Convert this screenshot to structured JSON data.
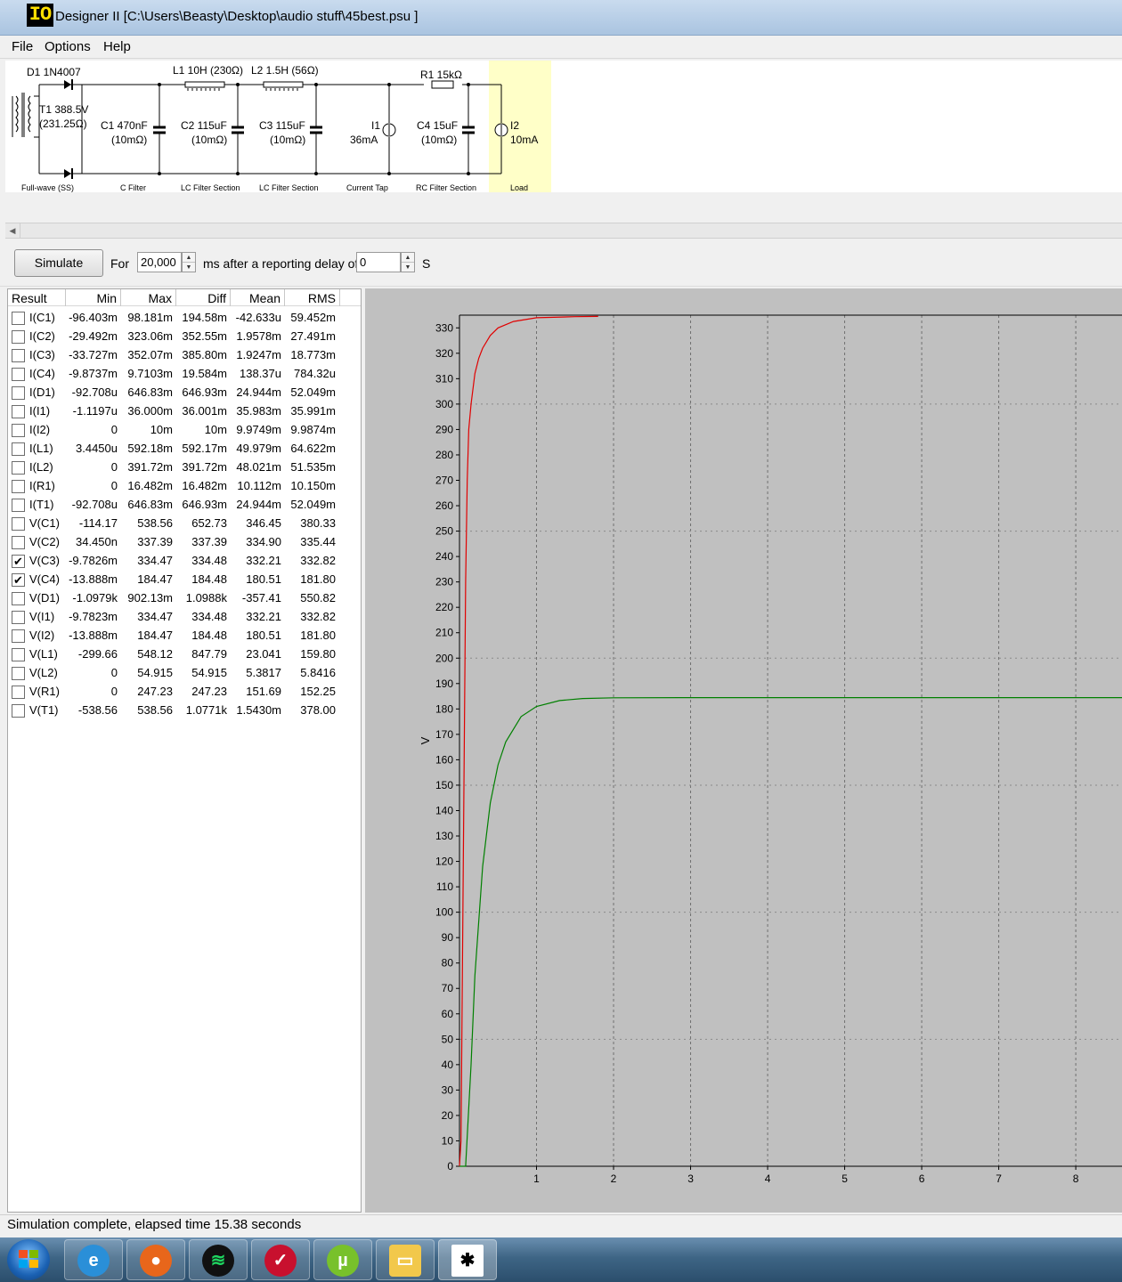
{
  "window": {
    "logo": "IO",
    "title": "Designer II  [C:\\Users\\Beasty\\Desktop\\audio stuff\\45best.psu ]"
  },
  "menu": {
    "file": "File",
    "options": "Options",
    "help": "Help"
  },
  "schematic": {
    "d1": "D1 1N4007",
    "t1_a": "T1 388.5V",
    "t1_b": "(231.25Ω)",
    "l1": "L1 10H (230Ω)",
    "l2": "L2 1.5H (56Ω)",
    "r1": "R1 15kΩ",
    "c1_a": "C1 470nF",
    "c1_b": "(10mΩ)",
    "c2_a": "C2 115uF",
    "c2_b": "(10mΩ)",
    "c3_a": "C3 115uF",
    "c3_b": "(10mΩ)",
    "i1_a": "I1",
    "i1_b": "36mA",
    "c4_a": "C4 15uF",
    "c4_b": "(10mΩ)",
    "i2_a": "I2",
    "i2_b": "10mA",
    "sections": [
      "Full-wave (SS)",
      "C Filter",
      "LC Filter Section",
      "LC Filter Section",
      "Current Tap",
      "RC Filter Section",
      "Load"
    ]
  },
  "toolbar": {
    "simulate": "Simulate",
    "for_label": "For",
    "duration": "20,000",
    "ms_label": "ms  after a reporting delay of",
    "delay": "0",
    "s_label": "S"
  },
  "results": {
    "columns": [
      "Result",
      "Min",
      "Max",
      "Diff",
      "Mean",
      "RMS"
    ],
    "rows": [
      {
        "checked": false,
        "name": "I(C1)",
        "min": "-96.403m",
        "max": "98.181m",
        "diff": "194.58m",
        "mean": "-42.633u",
        "rms": "59.452m"
      },
      {
        "checked": false,
        "name": "I(C2)",
        "min": "-29.492m",
        "max": "323.06m",
        "diff": "352.55m",
        "mean": "1.9578m",
        "rms": "27.491m"
      },
      {
        "checked": false,
        "name": "I(C3)",
        "min": "-33.727m",
        "max": "352.07m",
        "diff": "385.80m",
        "mean": "1.9247m",
        "rms": "18.773m"
      },
      {
        "checked": false,
        "name": "I(C4)",
        "min": "-9.8737m",
        "max": "9.7103m",
        "diff": "19.584m",
        "mean": "138.37u",
        "rms": "784.32u"
      },
      {
        "checked": false,
        "name": "I(D1)",
        "min": "-92.708u",
        "max": "646.83m",
        "diff": "646.93m",
        "mean": "24.944m",
        "rms": "52.049m"
      },
      {
        "checked": false,
        "name": "I(I1)",
        "min": "-1.1197u",
        "max": "36.000m",
        "diff": "36.001m",
        "mean": "35.983m",
        "rms": "35.991m"
      },
      {
        "checked": false,
        "name": "I(I2)",
        "min": "0",
        "max": "10m",
        "diff": "10m",
        "mean": "9.9749m",
        "rms": "9.9874m"
      },
      {
        "checked": false,
        "name": "I(L1)",
        "min": "3.4450u",
        "max": "592.18m",
        "diff": "592.17m",
        "mean": "49.979m",
        "rms": "64.622m"
      },
      {
        "checked": false,
        "name": "I(L2)",
        "min": "0",
        "max": "391.72m",
        "diff": "391.72m",
        "mean": "48.021m",
        "rms": "51.535m"
      },
      {
        "checked": false,
        "name": "I(R1)",
        "min": "0",
        "max": "16.482m",
        "diff": "16.482m",
        "mean": "10.112m",
        "rms": "10.150m"
      },
      {
        "checked": false,
        "name": "I(T1)",
        "min": "-92.708u",
        "max": "646.83m",
        "diff": "646.93m",
        "mean": "24.944m",
        "rms": "52.049m"
      },
      {
        "checked": false,
        "name": "V(C1)",
        "min": "-114.17",
        "max": "538.56",
        "diff": "652.73",
        "mean": "346.45",
        "rms": "380.33"
      },
      {
        "checked": false,
        "name": "V(C2)",
        "min": "34.450n",
        "max": "337.39",
        "diff": "337.39",
        "mean": "334.90",
        "rms": "335.44"
      },
      {
        "checked": true,
        "name": "V(C3)",
        "min": "-9.7826m",
        "max": "334.47",
        "diff": "334.48",
        "mean": "332.21",
        "rms": "332.82"
      },
      {
        "checked": true,
        "name": "V(C4)",
        "min": "-13.888m",
        "max": "184.47",
        "diff": "184.48",
        "mean": "180.51",
        "rms": "181.80"
      },
      {
        "checked": false,
        "name": "V(D1)",
        "min": "-1.0979k",
        "max": "902.13m",
        "diff": "1.0988k",
        "mean": "-357.41",
        "rms": "550.82"
      },
      {
        "checked": false,
        "name": "V(I1)",
        "min": "-9.7823m",
        "max": "334.47",
        "diff": "334.48",
        "mean": "332.21",
        "rms": "332.82"
      },
      {
        "checked": false,
        "name": "V(I2)",
        "min": "-13.888m",
        "max": "184.47",
        "diff": "184.48",
        "mean": "180.51",
        "rms": "181.80"
      },
      {
        "checked": false,
        "name": "V(L1)",
        "min": "-299.66",
        "max": "548.12",
        "diff": "847.79",
        "mean": "23.041",
        "rms": "159.80"
      },
      {
        "checked": false,
        "name": "V(L2)",
        "min": "0",
        "max": "54.915",
        "diff": "54.915",
        "mean": "5.3817",
        "rms": "5.8416"
      },
      {
        "checked": false,
        "name": "V(R1)",
        "min": "0",
        "max": "247.23",
        "diff": "247.23",
        "mean": "151.69",
        "rms": "152.25"
      },
      {
        "checked": false,
        "name": "V(T1)",
        "min": "-538.56",
        "max": "538.56",
        "diff": "1.0771k",
        "mean": "1.5430m",
        "rms": "378.00"
      }
    ]
  },
  "chart_data": {
    "type": "line",
    "ylabel": "V",
    "xlabel": "",
    "xlim": [
      0,
      8.6
    ],
    "ylim": [
      0,
      335
    ],
    "x_ticks": [
      1,
      2,
      3,
      4,
      5,
      6,
      7,
      8
    ],
    "y_ticks": [
      0,
      10,
      20,
      30,
      40,
      50,
      60,
      70,
      80,
      90,
      100,
      110,
      120,
      130,
      140,
      150,
      160,
      170,
      180,
      190,
      200,
      210,
      220,
      230,
      240,
      250,
      260,
      270,
      280,
      290,
      300,
      310,
      320,
      330
    ],
    "grid": true,
    "series": [
      {
        "color": "#e00000",
        "x": [
          0,
          0.02,
          0.05,
          0.08,
          0.1,
          0.12,
          0.15,
          0.2,
          0.25,
          0.3,
          0.4,
          0.5,
          0.7,
          1.0,
          1.5,
          1.8
        ],
        "y": [
          0,
          10,
          120,
          230,
          270,
          290,
          300,
          312,
          318,
          322,
          327,
          330,
          332.5,
          334,
          334.4,
          334.5
        ]
      },
      {
        "color": "#008000",
        "x": [
          0,
          0.08,
          0.15,
          0.2,
          0.3,
          0.4,
          0.5,
          0.6,
          0.8,
          1.0,
          1.3,
          1.6,
          2.0,
          3.0,
          5.0,
          8.6
        ],
        "y": [
          0,
          0,
          40,
          75,
          118,
          143,
          158,
          167,
          177,
          181,
          183.3,
          184.1,
          184.4,
          184.47,
          184.47,
          184.47
        ]
      }
    ]
  },
  "status": "Simulation complete, elapsed time 15.38 seconds",
  "taskbar": {
    "apps": [
      "internet-explorer",
      "firefox",
      "spotify",
      "mail-app",
      "utorrent",
      "file-explorer",
      "psu-designer"
    ]
  }
}
